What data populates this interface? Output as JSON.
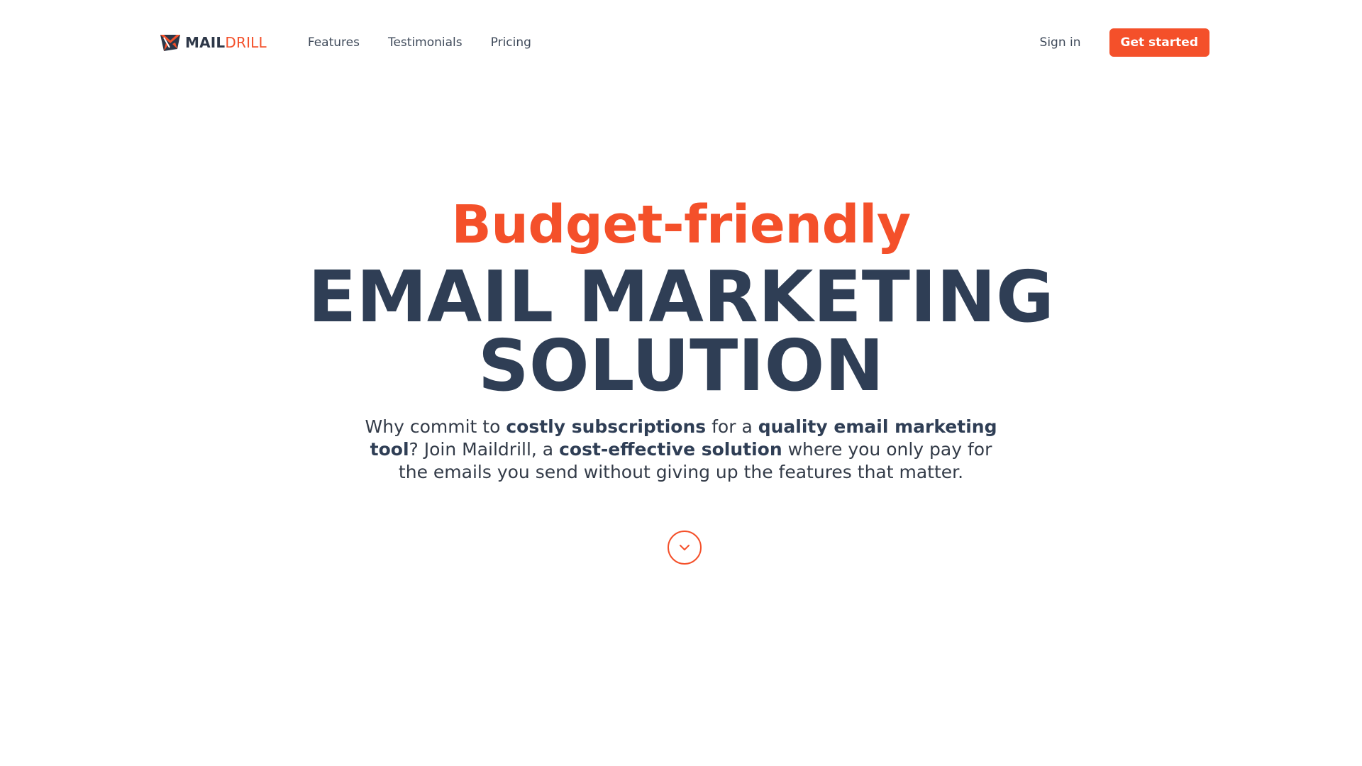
{
  "brand": {
    "name_part1": "MAIL",
    "name_part2": "DRILL",
    "icon": "maildrill-logo-icon",
    "accent_color": "#f4502a",
    "dark_color": "#2f3e55"
  },
  "nav": {
    "items": [
      {
        "label": "Features"
      },
      {
        "label": "Testimonials"
      },
      {
        "label": "Pricing"
      }
    ],
    "sign_in_label": "Sign in",
    "get_started_label": "Get started"
  },
  "hero": {
    "eyebrow": "Budget-friendly",
    "title_line1": "EMAIL MARKETING",
    "title_line2": "SOLUTION",
    "subtitle": {
      "p1": "Why commit to ",
      "b1": "costly subscriptions",
      "p2": " for a ",
      "b2": "quality email marketing tool",
      "p3": "? Join Maildrill, a ",
      "b3": "cost-effective solution",
      "p4": " where you only pay for the emails you send without giving up the features that matter."
    },
    "scroll_icon": "chevron-down-icon"
  }
}
